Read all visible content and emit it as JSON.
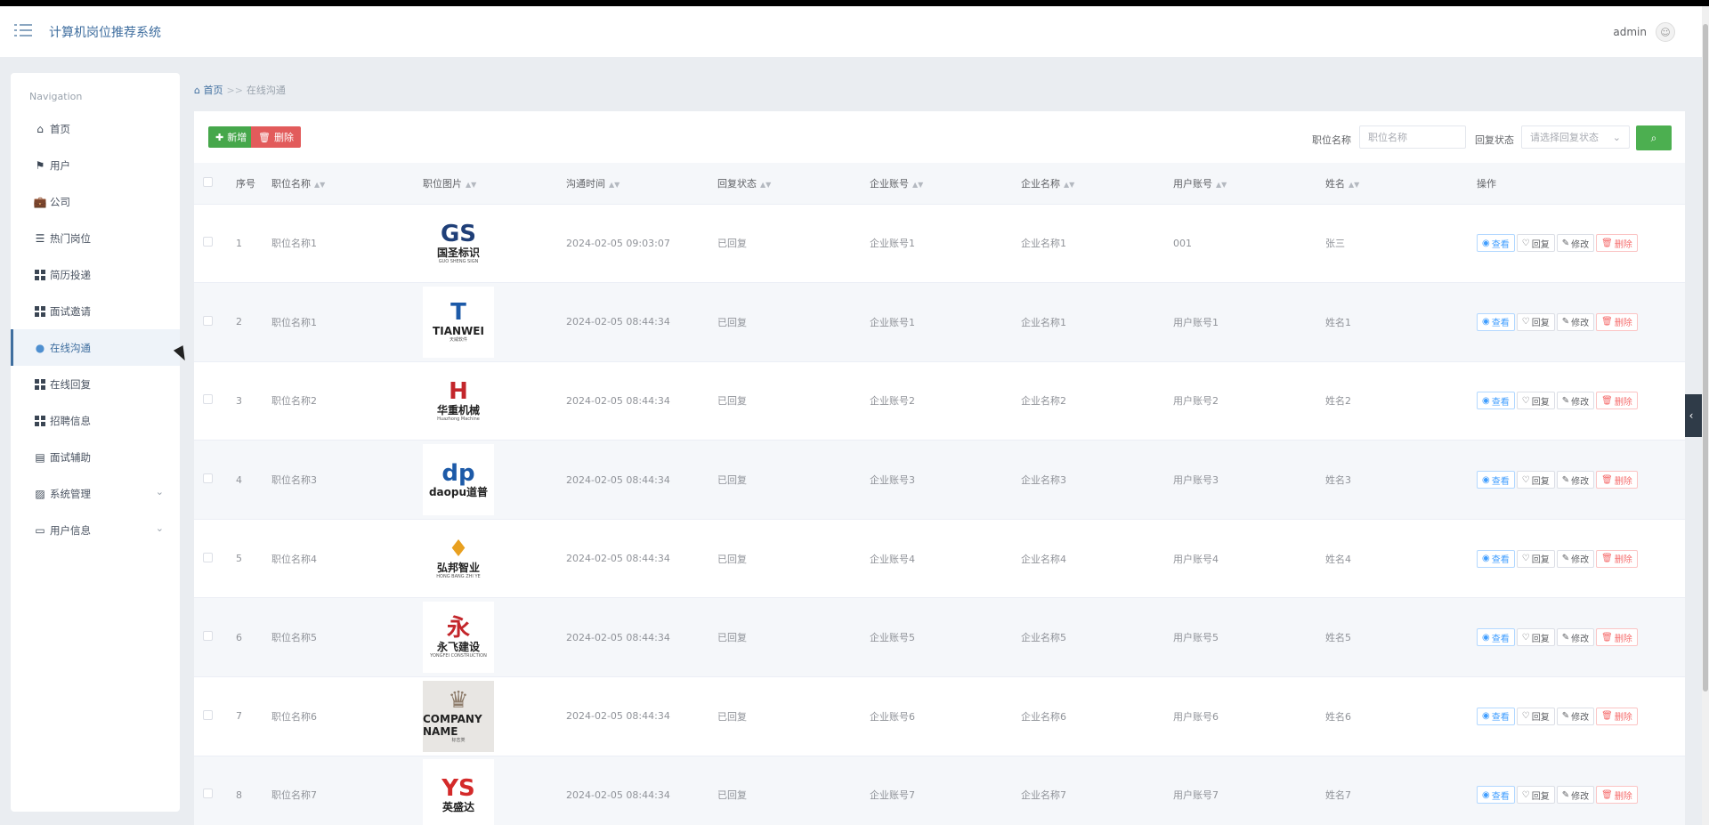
{
  "app": {
    "title": "计算机岗位推荐系统",
    "user": "admin"
  },
  "sidebar": {
    "label": "Navigation",
    "items": [
      {
        "label": "首页",
        "icon": "home-icon"
      },
      {
        "label": "用户",
        "icon": "flag-icon"
      },
      {
        "label": "公司",
        "icon": "briefcase-icon"
      },
      {
        "label": "热门岗位",
        "icon": "list-icon"
      },
      {
        "label": "简历投递",
        "icon": "grid-icon"
      },
      {
        "label": "面试邀请",
        "icon": "grid-icon"
      },
      {
        "label": "在线沟通",
        "icon": "location-pin-icon",
        "active": true
      },
      {
        "label": "在线回复",
        "icon": "grid-icon"
      },
      {
        "label": "招聘信息",
        "icon": "grid-icon"
      },
      {
        "label": "面试辅助",
        "icon": "chat-icon"
      },
      {
        "label": "系统管理",
        "icon": "chart-icon",
        "expandable": true
      },
      {
        "label": "用户信息",
        "icon": "wallet-icon",
        "expandable": true
      }
    ]
  },
  "breadcrumb": {
    "home": "首页",
    "sep": ">>",
    "current": "在线沟通"
  },
  "toolbar": {
    "add_label": "新增",
    "delete_label": "删除",
    "filter_job_label": "职位名称",
    "filter_job_placeholder": "职位名称",
    "filter_status_label": "回复状态",
    "filter_status_placeholder": "请选择回复状态"
  },
  "table": {
    "headers": [
      "序号",
      "职位名称",
      "职位图片",
      "沟通时间",
      "回复状态",
      "企业账号",
      "企业名称",
      "用户账号",
      "姓名",
      "操作"
    ],
    "actions": {
      "view": "查看",
      "reply": "回复",
      "edit": "修改",
      "delete": "删除"
    },
    "rows": [
      {
        "no": "1",
        "job": "职位名称1",
        "logo": {
          "mark": "GS",
          "name": "国圣标识",
          "sub": "GUO SHENG SIGN",
          "color": "#1f3f78"
        },
        "time": "2024-02-05 09:03:07",
        "status": "已回复",
        "corp_acct": "企业账号1",
        "corp_name": "企业名称1",
        "user_acct": "001",
        "name": "张三"
      },
      {
        "no": "2",
        "job": "职位名称1",
        "logo": {
          "mark": "T",
          "name": "TIANWEI",
          "sub": "天威软件",
          "color": "#1d5aa8"
        },
        "time": "2024-02-05 08:44:34",
        "status": "已回复",
        "corp_acct": "企业账号1",
        "corp_name": "企业名称1",
        "user_acct": "用户账号1",
        "name": "姓名1"
      },
      {
        "no": "3",
        "job": "职位名称2",
        "logo": {
          "mark": "H",
          "name": "华重机械",
          "sub": "Huazhong Machine",
          "color": "#c3262b"
        },
        "time": "2024-02-05 08:44:34",
        "status": "已回复",
        "corp_acct": "企业账号2",
        "corp_name": "企业名称2",
        "user_acct": "用户账号2",
        "name": "姓名2"
      },
      {
        "no": "4",
        "job": "职位名称3",
        "logo": {
          "mark": "dp",
          "name": "daopu道普",
          "sub": "",
          "color": "#1d5aa8"
        },
        "time": "2024-02-05 08:44:34",
        "status": "已回复",
        "corp_acct": "企业账号3",
        "corp_name": "企业名称3",
        "user_acct": "用户账号3",
        "name": "姓名3"
      },
      {
        "no": "5",
        "job": "职位名称4",
        "logo": {
          "mark": "♦",
          "name": "弘邦智业",
          "sub": "HONG BANG ZHI YE",
          "color": "#e8a020"
        },
        "time": "2024-02-05 08:44:34",
        "status": "已回复",
        "corp_acct": "企业账号4",
        "corp_name": "企业名称4",
        "user_acct": "用户账号4",
        "name": "姓名4"
      },
      {
        "no": "6",
        "job": "职位名称5",
        "logo": {
          "mark": "永",
          "name": "永飞建设",
          "sub": "YONGFEI CONSTRUCTION",
          "color": "#c3262b"
        },
        "time": "2024-02-05 08:44:34",
        "status": "已回复",
        "corp_acct": "企业账号5",
        "corp_name": "企业名称5",
        "user_acct": "用户账号5",
        "name": "姓名5"
      },
      {
        "no": "7",
        "job": "职位名称6",
        "logo": {
          "mark": "♛",
          "name": "COMPANY NAME",
          "sub": "标志类",
          "color": "#8d7b6a",
          "grey": true
        },
        "time": "2024-02-05 08:44:34",
        "status": "已回复",
        "corp_acct": "企业账号6",
        "corp_name": "企业名称6",
        "user_acct": "用户账号6",
        "name": "姓名6"
      },
      {
        "no": "8",
        "job": "职位名称7",
        "logo": {
          "mark": "YS",
          "name": "英盛达",
          "sub": "",
          "color": "#d42a2a"
        },
        "time": "2024-02-05 08:44:34",
        "status": "已回复",
        "corp_acct": "企业账号7",
        "corp_name": "企业名称7",
        "user_acct": "用户账号7",
        "name": "姓名7"
      }
    ]
  },
  "colors": {
    "primary": "#3f6e9f",
    "success": "#46a74b",
    "danger": "#e25b5b",
    "link": "#409eff"
  }
}
